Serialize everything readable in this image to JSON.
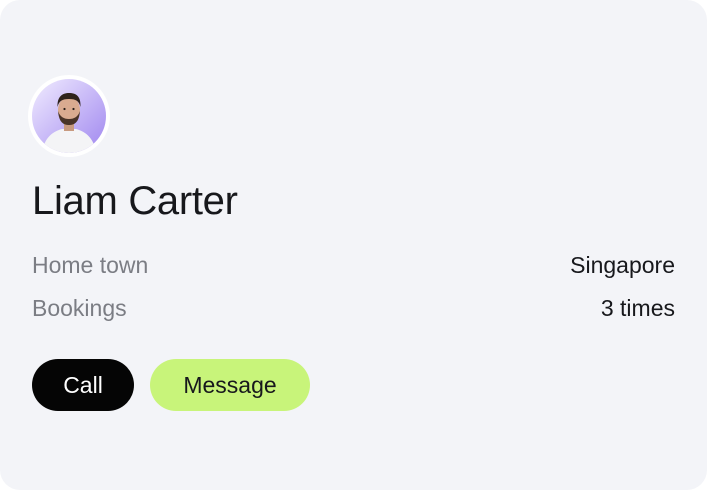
{
  "profile": {
    "name": "Liam Carter",
    "avatar_icon": "person-avatar-icon"
  },
  "details": [
    {
      "label": "Home town",
      "value": "Singapore"
    },
    {
      "label": "Bookings",
      "value": "3 times"
    }
  ],
  "actions": {
    "call_label": "Call",
    "message_label": "Message"
  },
  "colors": {
    "card_background": "#f3f4f8",
    "call_button": "#050505",
    "message_button": "#c8f47a",
    "avatar_gradient_start": "#efe9ff",
    "avatar_gradient_end": "#a58df2"
  }
}
